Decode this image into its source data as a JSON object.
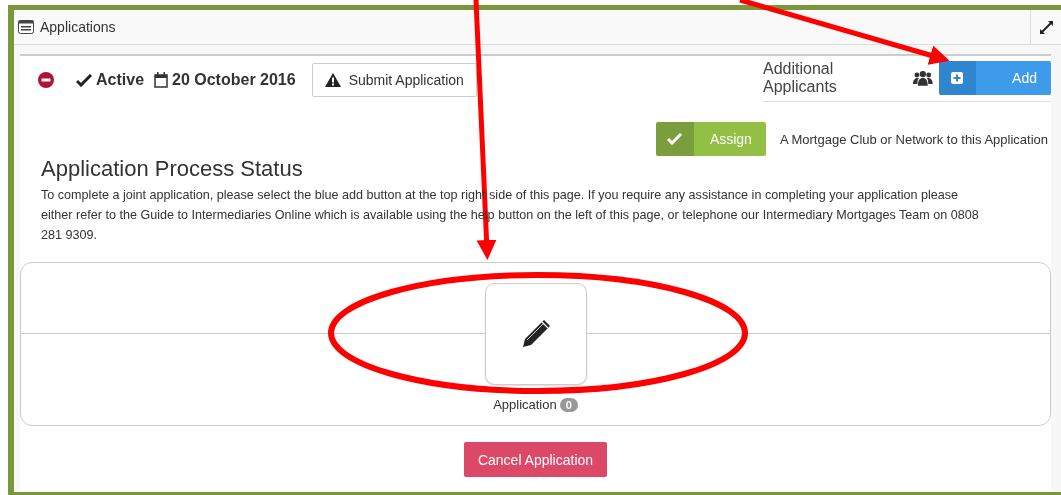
{
  "panel": {
    "title": "Applications"
  },
  "status": {
    "state": "Active",
    "date": "20 October 2016"
  },
  "submit_button": "Submit Application",
  "additional_applicants": {
    "label": "Additional Applicants",
    "button": "Add"
  },
  "assign": {
    "button": "Assign",
    "text": "A Mortgage Club or Network to this Application"
  },
  "heading": "Application Process Status",
  "description": "To complete a joint application, please select the blue add button at the top right side of this page. If you require any assistance in completing your application please either refer to the Guide to Intermediaries Online which is available using the help button on the left of this page, or telephone our Intermediary Mortgages Team on 0808 281 9309.",
  "stages": [
    {
      "label": "Application",
      "count": "0"
    }
  ],
  "cancel_button": "Cancel Application"
}
